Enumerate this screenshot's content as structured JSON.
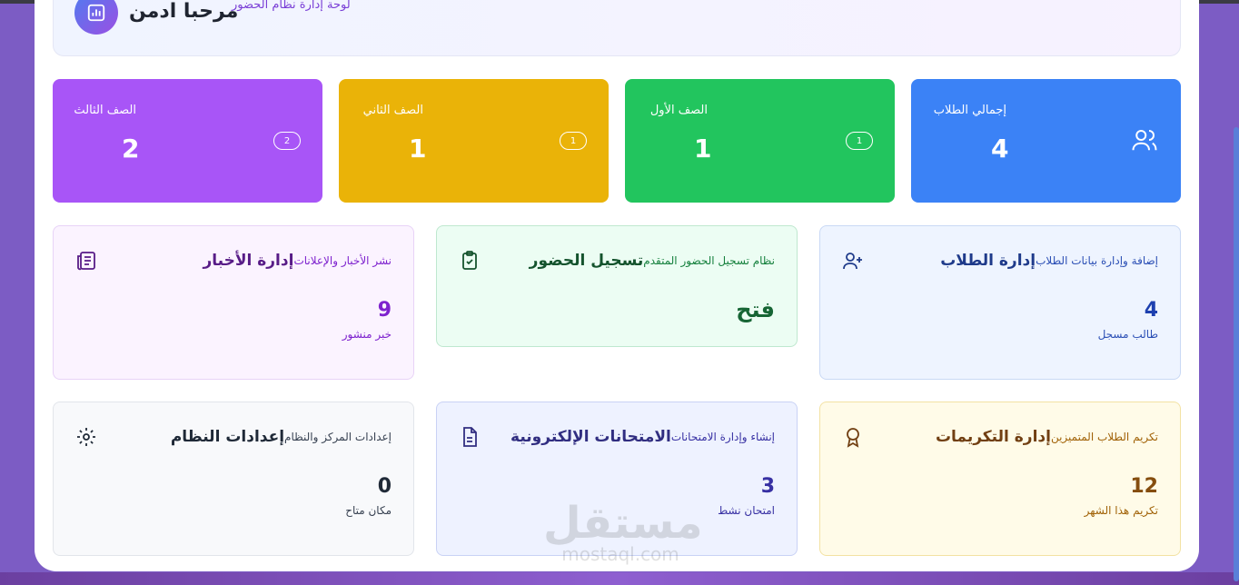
{
  "welcome": {
    "title": "مرحبا ادمن",
    "subtitle": "لوحة إدارة نظام الحضور"
  },
  "stats": [
    {
      "label": "إجمالي الطلاب",
      "value": "4",
      "color": "#3b82f6",
      "icon": "users-icon"
    },
    {
      "label": "الصف الأول",
      "value": "1",
      "badge": "1",
      "color": "#22c55e"
    },
    {
      "label": "الصف الثاني",
      "value": "1",
      "badge": "1",
      "color": "#eab308"
    },
    {
      "label": "الصف الثالث",
      "value": "2",
      "badge": "2",
      "color": "#a855f7"
    }
  ],
  "cards": {
    "students": {
      "title": "إدارة الطلاب",
      "subtitle": "إضافة وإدارة بيانات الطلاب",
      "value": "4",
      "note": "طالب مسجل",
      "icon": "user-plus-icon"
    },
    "attendance": {
      "title": "تسجيل الحضور",
      "subtitle": "نظام تسجيل الحضور المتقدم",
      "value": "فتح",
      "icon": "clipboard-check-icon"
    },
    "news": {
      "title": "إدارة الأخبار",
      "subtitle": "نشر الأخبار والإعلانات",
      "value": "9",
      "note": "خبر منشور",
      "icon": "newspaper-icon"
    },
    "awards": {
      "title": "إدارة التكريمات",
      "subtitle": "تكريم الطلاب المتميزين",
      "value": "12",
      "note": "تكريم هذا الشهر",
      "icon": "award-icon"
    },
    "exams": {
      "title": "الامتحانات الإلكترونية",
      "subtitle": "إنشاء وإدارة الامتحانات",
      "value": "3",
      "note": "امتحان نشط",
      "icon": "document-icon"
    },
    "settings": {
      "title": "إعدادات النظام",
      "subtitle": "إعدادات المركز والنظام",
      "value": "0",
      "note": "مكان متاح",
      "icon": "gear-icon"
    }
  },
  "watermark": {
    "arabic": "مستقل",
    "latin": "mostaql.com"
  }
}
